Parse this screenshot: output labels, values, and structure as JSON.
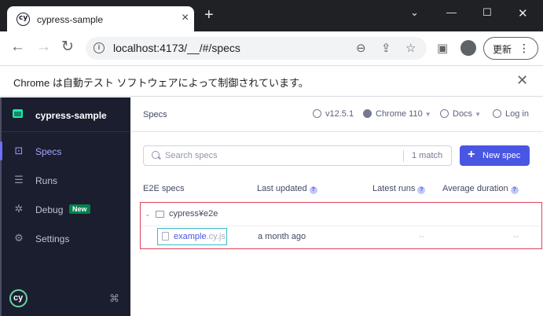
{
  "browser": {
    "tab_title": "cypress-sample",
    "favicon_text": "cy",
    "url": "localhost:4173/__/#/specs",
    "update_label": "更新",
    "infobar_text": "Chrome は自動テスト ソフトウェアによって制御されています。"
  },
  "sidebar": {
    "project_name": "cypress-sample",
    "items": [
      {
        "label": "Specs",
        "icon": "specs-icon",
        "active": true
      },
      {
        "label": "Runs",
        "icon": "runs-icon",
        "active": false
      },
      {
        "label": "Debug",
        "icon": "debug-icon",
        "active": false,
        "badge": "New"
      },
      {
        "label": "Settings",
        "icon": "settings-icon",
        "active": false
      }
    ],
    "logo_text": "cy",
    "keyboard_glyph": "⌘"
  },
  "header": {
    "breadcrumb": "Specs",
    "version": "v12.5.1",
    "browser": "Chrome 110",
    "docs": "Docs",
    "login": "Log in"
  },
  "search": {
    "placeholder": "Search specs",
    "match_count": "1 match"
  },
  "new_spec_label": "New spec",
  "columns": {
    "name": "E2E specs",
    "updated": "Last updated",
    "runs": "Latest runs",
    "duration": "Average duration"
  },
  "specs": {
    "folder": "cypress¥e2e",
    "file_name": "example",
    "file_ext": ".cy.js",
    "last_updated": "a month ago",
    "latest_runs": "--",
    "average_duration": "--"
  },
  "colors": {
    "accent": "#4956e3",
    "sidebar_bg": "#1b1e2e",
    "highlight_border": "#e0425a",
    "badge_bg": "#00814d"
  }
}
